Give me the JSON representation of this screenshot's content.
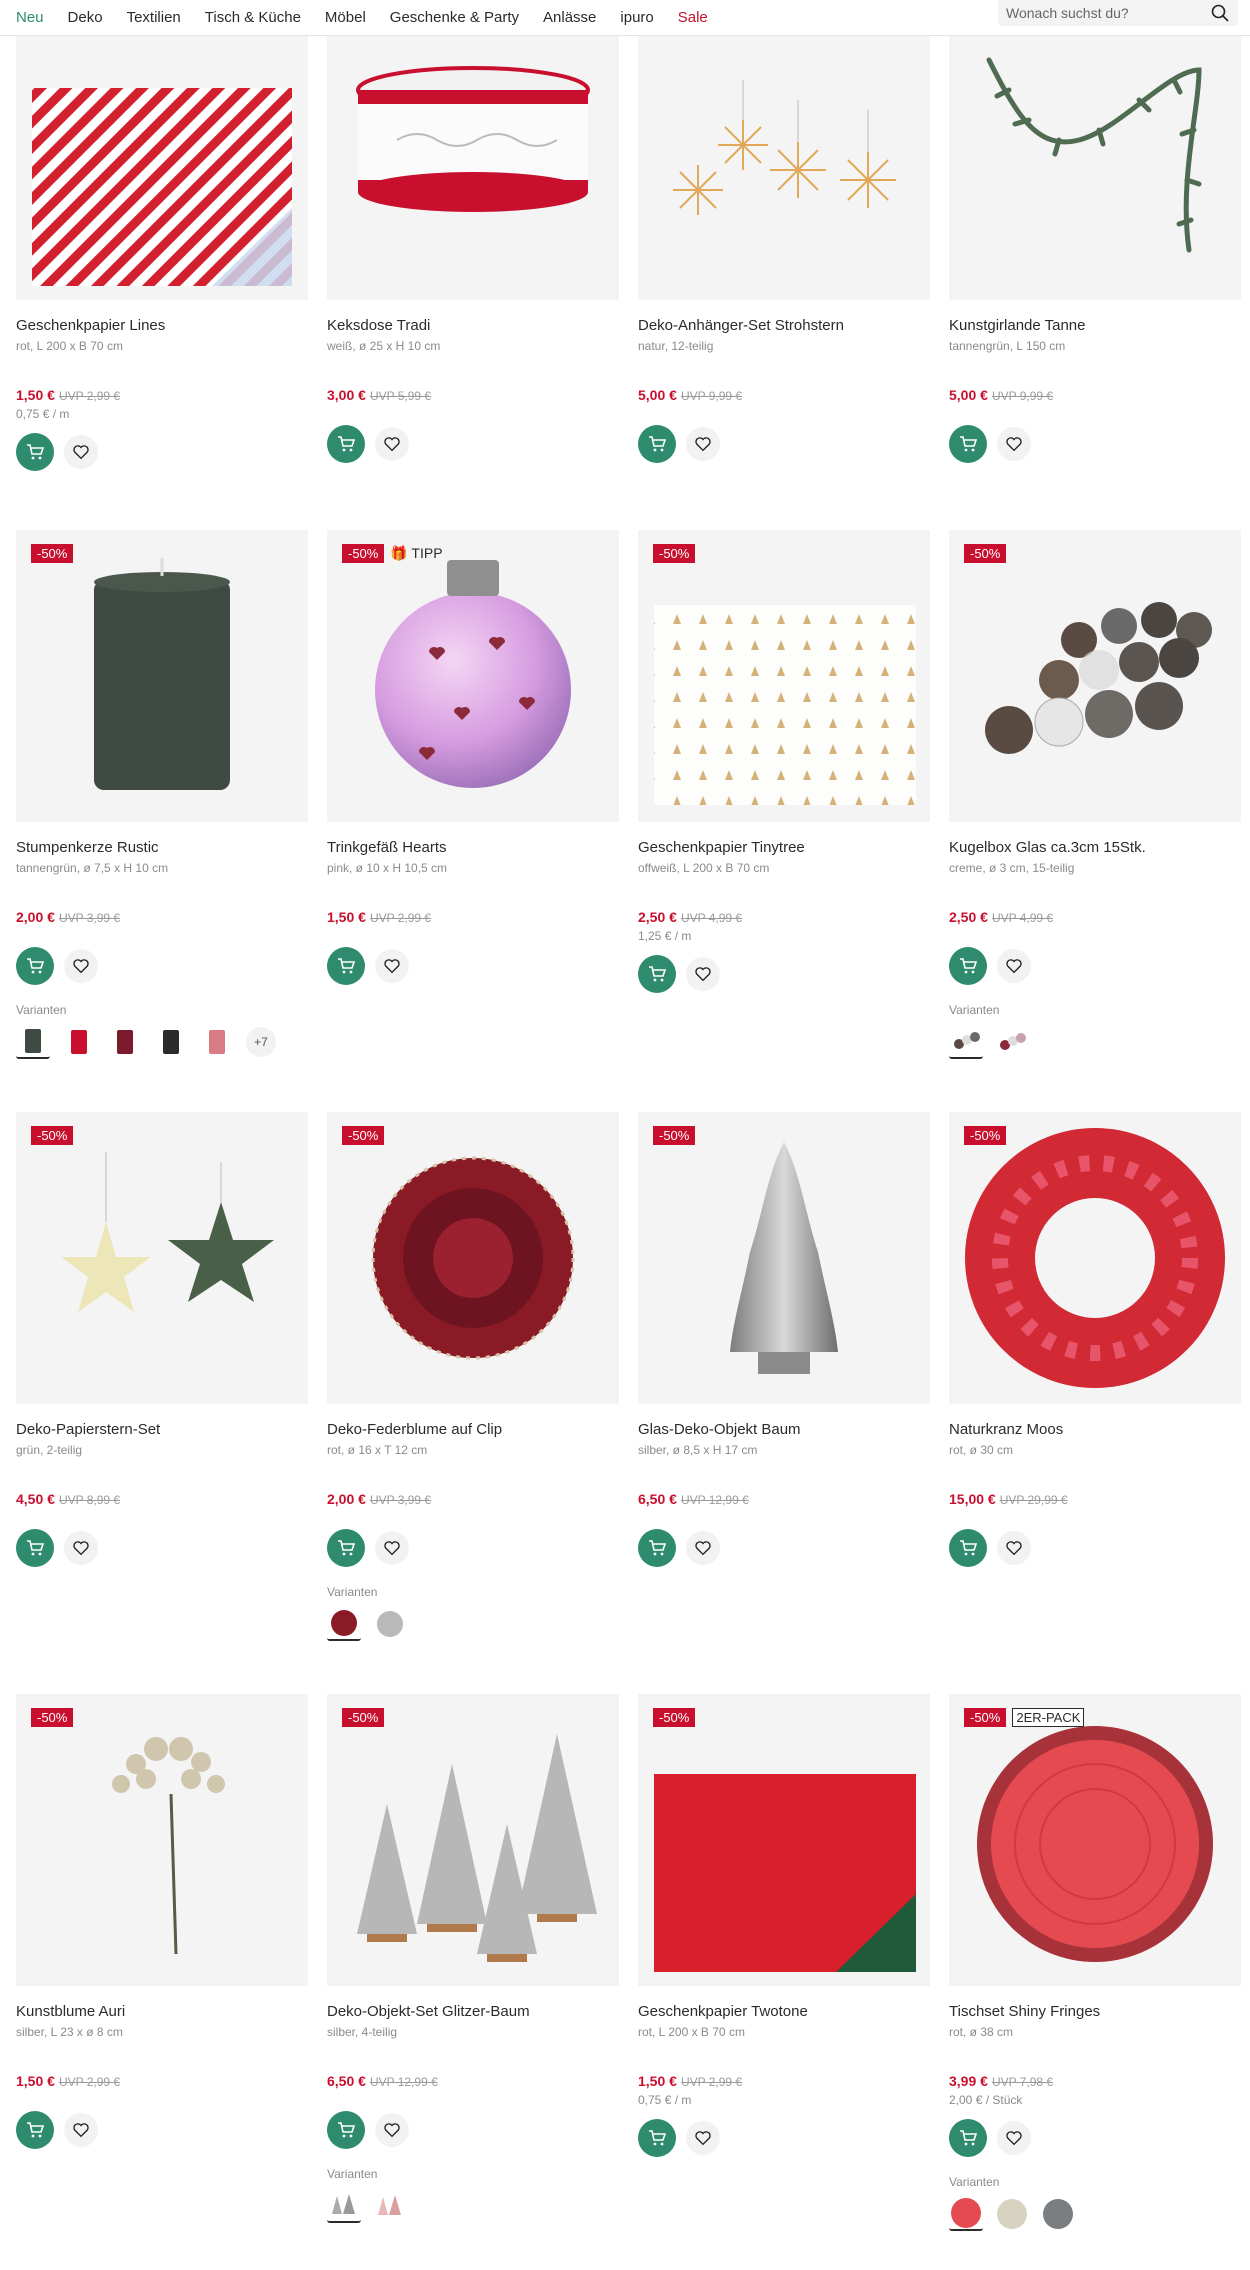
{
  "nav": {
    "items": [
      "Neu",
      "Deko",
      "Textilien",
      "Tisch & Küche",
      "Möbel",
      "Geschenke & Party",
      "Anlässe",
      "ipuro",
      "Sale"
    ],
    "search_placeholder": "Wonach suchst du?"
  },
  "colors": {
    "accent": "#2e8b6e",
    "sale": "#c8102e"
  },
  "products": [
    {
      "name": "Geschenkpapier Lines",
      "sub": "rot, L 200 x B 70 cm",
      "price": "1,50 €",
      "uvp": "UVP 2,99 €",
      "unit": "0,75 € / m"
    },
    {
      "name": "Keksdose Tradi",
      "sub": "weiß, ø 25 x H 10 cm",
      "price": "3,00 €",
      "uvp": "UVP 5,99 €"
    },
    {
      "name": "Deko-Anhänger-Set Strohstern",
      "sub": "natur, 12-teilig",
      "price": "5,00 €",
      "uvp": "UVP 9,99 €"
    },
    {
      "name": "Kunstgirlande Tanne",
      "sub": "tannengrün, L 150 cm",
      "price": "5,00 €",
      "uvp": "UVP 9,99 €"
    },
    {
      "name": "Stumpenkerze Rustic",
      "sub": "tannengrün, ø 7,5 x H 10 cm",
      "price": "2,00 €",
      "uvp": "UVP 3,99 €",
      "badge": "-50%",
      "variants_label": "Varianten",
      "variants_more": "+7"
    },
    {
      "name": "Trinkgefäß Hearts",
      "sub": "pink, ø 10 x H 10,5 cm",
      "price": "1,50 €",
      "uvp": "UVP 2,99 €",
      "badge": "-50%",
      "tipp": "🎁 TIPP"
    },
    {
      "name": "Geschenkpapier Tinytree",
      "sub": "offweiß, L 200 x B 70 cm",
      "price": "2,50 €",
      "uvp": "UVP 4,99 €",
      "unit": "1,25 € / m",
      "badge": "-50%"
    },
    {
      "name": "Kugelbox Glas ca.3cm 15Stk.",
      "sub": "creme, ø 3 cm, 15-teilig",
      "price": "2,50 €",
      "uvp": "UVP 4,99 €",
      "badge": "-50%",
      "variants_label": "Varianten"
    },
    {
      "name": "Deko-Papierstern-Set",
      "sub": "grün, 2-teilig",
      "price": "4,50 €",
      "uvp": "UVP 8,99 €",
      "badge": "-50%"
    },
    {
      "name": "Deko-Federblume auf Clip",
      "sub": "rot, ø 16 x T 12 cm",
      "price": "2,00 €",
      "uvp": "UVP 3,99 €",
      "badge": "-50%",
      "variants_label": "Varianten"
    },
    {
      "name": "Glas-Deko-Objekt Baum",
      "sub": "silber, ø 8,5 x H 17 cm",
      "price": "6,50 €",
      "uvp": "UVP 12,99 €",
      "badge": "-50%"
    },
    {
      "name": "Naturkranz Moos",
      "sub": "rot, ø 30 cm",
      "price": "15,00 €",
      "uvp": "UVP 29,99 €",
      "badge": "-50%"
    },
    {
      "name": "Kunstblume Auri",
      "sub": "silber, L 23 x ø 8 cm",
      "price": "1,50 €",
      "uvp": "UVP 2,99 €",
      "badge": "-50%"
    },
    {
      "name": "Deko-Objekt-Set Glitzer-Baum",
      "sub": "silber, 4-teilig",
      "price": "6,50 €",
      "uvp": "UVP 12,99 €",
      "badge": "-50%",
      "variants_label": "Varianten"
    },
    {
      "name": "Geschenkpapier Twotone",
      "sub": "rot, L 200 x B 70 cm",
      "price": "1,50 €",
      "uvp": "UVP 2,99 €",
      "unit": "0,75 € / m",
      "badge": "-50%"
    },
    {
      "name": "Tischset Shiny Fringes",
      "sub": "rot, ø 38 cm",
      "price": "3,99 €",
      "uvp": "UVP 7,98 €",
      "unit": "2,00 € / Stück",
      "badge": "-50%",
      "pack": "2ER-PACK",
      "variants_label": "Varianten"
    }
  ]
}
